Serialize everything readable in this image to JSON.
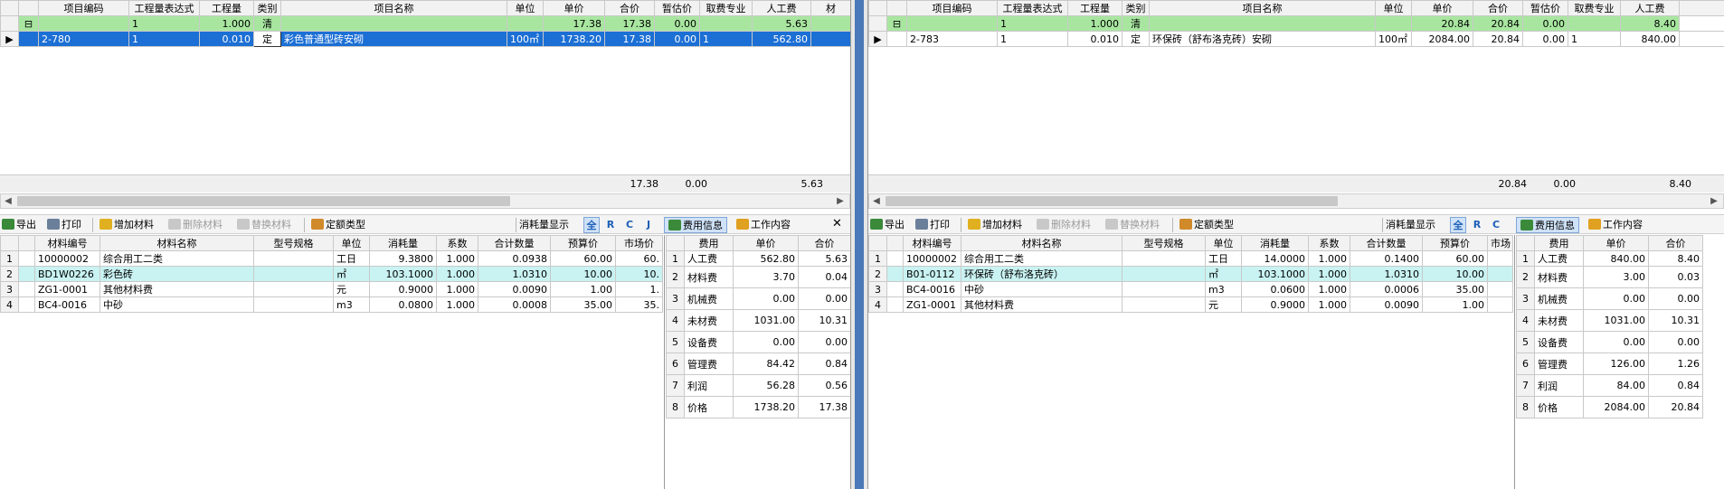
{
  "left": {
    "item_headers": [
      "项目编码",
      "工程量表达式",
      "工程量",
      "类别",
      "项目名称",
      "单位",
      "单价",
      "合价",
      "暂估价",
      "取费专业",
      "人工费",
      "材"
    ],
    "parent_row": {
      "marker": "⊟",
      "code": "",
      "expr": "1",
      "qty": "1.000",
      "type": "清",
      "name": "",
      "unit": "",
      "price": "17.38",
      "total": "17.38",
      "est": "0.00",
      "fee": "",
      "labor": "5.63"
    },
    "child_row": {
      "code": "2-780",
      "expr": "1",
      "qty": "0.010",
      "type": "定",
      "name": "彩色普通型砖安砌",
      "unit": "100㎡",
      "price": "1738.20",
      "total": "17.38",
      "est": "0.00",
      "fee": "1",
      "labor": "562.80"
    },
    "totals": {
      "total": "17.38",
      "est": "0.00",
      "labor": "5.63"
    },
    "toolbar": {
      "export": "导出",
      "print": "打印",
      "add_material": "增加材料",
      "delete_material": "删除材料",
      "replace_material": "替换材料",
      "quota_type": "定额类型",
      "consumption_display": "消耗量显示",
      "filter_all": "全",
      "filter_r": "R",
      "filter_c": "C",
      "filter_j": "J",
      "fee_info": "费用信息",
      "work_content": "工作内容",
      "close": "✕"
    },
    "mat_headers": [
      "材料编号",
      "材料名称",
      "型号规格",
      "单位",
      "消耗量",
      "系数",
      "合计数量",
      "预算价",
      "市场价"
    ],
    "materials": [
      {
        "no": "1",
        "code": "10000002",
        "name": "综合用工二类",
        "spec": "",
        "unit": "工日",
        "consume": "9.3800",
        "coef": "1.000",
        "sum": "0.0938",
        "budget": "60.00",
        "market": "60."
      },
      {
        "no": "2",
        "code": "BD1W0226",
        "name": "彩色砖",
        "spec": "",
        "unit": "㎡",
        "consume": "103.1000",
        "coef": "1.000",
        "sum": "1.0310",
        "budget": "10.00",
        "market": "10."
      },
      {
        "no": "3",
        "code": "ZG1-0001",
        "name": "其他材料费",
        "spec": "",
        "unit": "元",
        "consume": "0.9000",
        "coef": "1.000",
        "sum": "0.0090",
        "budget": "1.00",
        "market": "1."
      },
      {
        "no": "4",
        "code": "BC4-0016",
        "name": "中砂",
        "spec": "",
        "unit": "m3",
        "consume": "0.0800",
        "coef": "1.000",
        "sum": "0.0008",
        "budget": "35.00",
        "market": "35."
      }
    ],
    "fee_headers": [
      "费用",
      "单价",
      "合价"
    ],
    "fees": [
      {
        "no": "1",
        "name": "人工费",
        "price": "562.80",
        "total": "5.63"
      },
      {
        "no": "2",
        "name": "材料费",
        "price": "3.70",
        "total": "0.04"
      },
      {
        "no": "3",
        "name": "机械费",
        "price": "0.00",
        "total": "0.00"
      },
      {
        "no": "4",
        "name": "未材费",
        "price": "1031.00",
        "total": "10.31"
      },
      {
        "no": "5",
        "name": "设备费",
        "price": "0.00",
        "total": "0.00"
      },
      {
        "no": "6",
        "name": "管理费",
        "price": "84.42",
        "total": "0.84"
      },
      {
        "no": "7",
        "name": "利润",
        "price": "56.28",
        "total": "0.56"
      },
      {
        "no": "8",
        "name": "价格",
        "price": "1738.20",
        "total": "17.38"
      }
    ]
  },
  "right": {
    "item_headers": [
      "项目编码",
      "工程量表达式",
      "工程量",
      "类别",
      "项目名称",
      "单位",
      "单价",
      "合价",
      "暂估价",
      "取费专业",
      "人工费"
    ],
    "parent_row": {
      "marker": "⊟",
      "code": "",
      "expr": "1",
      "qty": "1.000",
      "type": "清",
      "name": "",
      "unit": "",
      "price": "20.84",
      "total": "20.84",
      "est": "0.00",
      "fee": "",
      "labor": "8.40"
    },
    "child_row": {
      "code": "2-783",
      "expr": "1",
      "qty": "0.010",
      "type": "定",
      "name": "环保砖（舒布洛克砖）安砌",
      "unit": "100㎡",
      "price": "2084.00",
      "total": "20.84",
      "est": "0.00",
      "fee": "1",
      "labor": "840.00"
    },
    "totals": {
      "total": "20.84",
      "est": "0.00",
      "labor": "8.40"
    },
    "toolbar": {
      "export": "导出",
      "print": "打印",
      "add_material": "增加材料",
      "delete_material": "删除材料",
      "replace_material": "替换材料",
      "quota_type": "定额类型",
      "consumption_display": "消耗量显示",
      "filter_all": "全",
      "filter_r": "R",
      "filter_c": "C",
      "fee_info": "费用信息",
      "work_content": "工作内容"
    },
    "mat_headers": [
      "材料编号",
      "材料名称",
      "型号规格",
      "单位",
      "消耗量",
      "系数",
      "合计数量",
      "预算价",
      "市场"
    ],
    "materials": [
      {
        "no": "1",
        "code": "10000002",
        "name": "综合用工二类",
        "spec": "",
        "unit": "工日",
        "consume": "14.0000",
        "coef": "1.000",
        "sum": "0.1400",
        "budget": "60.00",
        "market": ""
      },
      {
        "no": "2",
        "code": "B01-0112",
        "name": "环保砖（舒布洛克砖）",
        "spec": "",
        "unit": "㎡",
        "consume": "103.1000",
        "coef": "1.000",
        "sum": "1.0310",
        "budget": "10.00",
        "market": ""
      },
      {
        "no": "3",
        "code": "BC4-0016",
        "name": "中砂",
        "spec": "",
        "unit": "m3",
        "consume": "0.0600",
        "coef": "1.000",
        "sum": "0.0006",
        "budget": "35.00",
        "market": ""
      },
      {
        "no": "4",
        "code": "ZG1-0001",
        "name": "其他材料费",
        "spec": "",
        "unit": "元",
        "consume": "0.9000",
        "coef": "1.000",
        "sum": "0.0090",
        "budget": "1.00",
        "market": ""
      }
    ],
    "fee_headers": [
      "费用",
      "单价",
      "合价"
    ],
    "fees": [
      {
        "no": "1",
        "name": "人工费",
        "price": "840.00",
        "total": "8.40"
      },
      {
        "no": "2",
        "name": "材料费",
        "price": "3.00",
        "total": "0.03"
      },
      {
        "no": "3",
        "name": "机械费",
        "price": "0.00",
        "total": "0.00"
      },
      {
        "no": "4",
        "name": "未材费",
        "price": "1031.00",
        "total": "10.31"
      },
      {
        "no": "5",
        "name": "设备费",
        "price": "0.00",
        "total": "0.00"
      },
      {
        "no": "6",
        "name": "管理费",
        "price": "126.00",
        "total": "1.26"
      },
      {
        "no": "7",
        "name": "利润",
        "price": "84.00",
        "total": "0.84"
      },
      {
        "no": "8",
        "name": "价格",
        "price": "2084.00",
        "total": "20.84"
      }
    ]
  }
}
